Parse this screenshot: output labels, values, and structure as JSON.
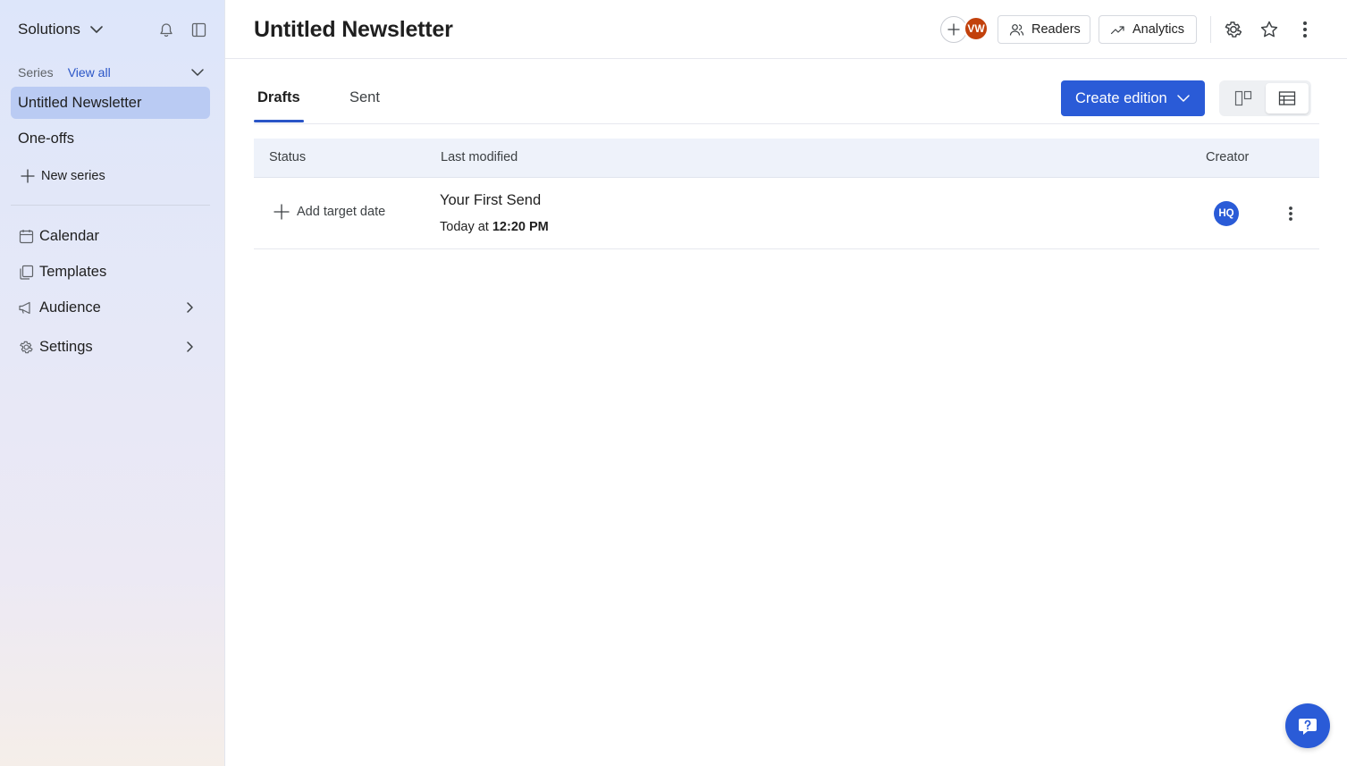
{
  "sidebar": {
    "workspace": "Solutions",
    "series_label": "Series",
    "view_all": "View all",
    "items": [
      {
        "label": "Untitled Newsletter"
      },
      {
        "label": "One-offs"
      },
      {
        "label": "New series"
      },
      {
        "label": "Calendar",
        "icon": "calendar-icon"
      },
      {
        "label": "Templates",
        "icon": "templates-icon"
      },
      {
        "label": "Audience",
        "icon": "megaphone-icon"
      },
      {
        "label": "Settings",
        "icon": "gear-icon"
      }
    ]
  },
  "header": {
    "title": "Untitled Newsletter",
    "collaborator_initials": "VW",
    "readers_label": "Readers",
    "analytics_label": "Analytics"
  },
  "tabs": [
    {
      "label": "Drafts",
      "active": true
    },
    {
      "label": "Sent",
      "active": false
    }
  ],
  "toolbar": {
    "create_label": "Create edition"
  },
  "table": {
    "columns": [
      "Status",
      "Last modified",
      "Creator"
    ],
    "rows": [
      {
        "status_action": "Add target date",
        "title": "Your First Send",
        "time_prefix": "Today at",
        "time": "12:20 PM",
        "creator_initials": "HQ"
      }
    ]
  },
  "colors": {
    "accent": "#2a5bd7",
    "collaborator_avatar": "#c2410c",
    "active_nav": "#adc2f0"
  }
}
